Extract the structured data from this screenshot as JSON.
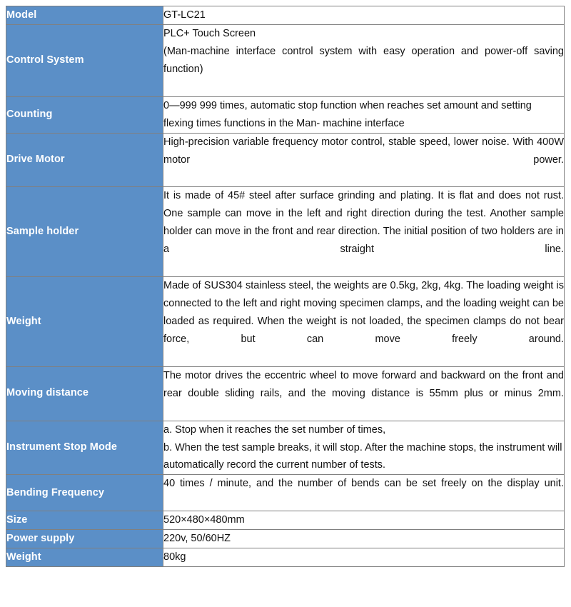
{
  "document": {
    "kind": "product-specification-table",
    "accent_color": "#5b8fc7",
    "label_text_color": "#ffffff",
    "value_text_color": "#111111",
    "border_color": "#808080",
    "background_color": "#ffffff"
  },
  "table": {
    "rows": [
      {
        "label": "Model",
        "lines": [
          {
            "text": "GT-LC21",
            "align": "left"
          }
        ]
      },
      {
        "label": "Control System",
        "lines": [
          {
            "text": "PLC+ Touch Screen",
            "align": "left"
          },
          {
            "text": "(Man-machine interface control system with easy operation and power-off saving function)",
            "align": "justify"
          }
        ]
      },
      {
        "label": "Counting",
        "lines": [
          {
            "text": "0—999 999 times, automatic stop function when reaches set amount and setting flexing times functions in the Man- machine interface",
            "align": "left"
          }
        ]
      },
      {
        "label": "Drive Motor",
        "lines": [
          {
            "text": "High-precision variable frequency motor control, stable speed, lower noise. With 400W motor power.",
            "align": "justify"
          }
        ]
      },
      {
        "label": "Sample holder",
        "lines": [
          {
            "text": "It is made of 45# steel after surface grinding and plating. It is flat and does not rust. One sample can move in the left and right direction during the test. Another sample holder can move in the front and rear direction. The initial position of two holders are in a straight line.",
            "align": "justify"
          }
        ]
      },
      {
        "label": "Weight",
        "lines": [
          {
            "text": "Made of SUS304 stainless steel, the weights are 0.5kg, 2kg, 4kg. The loading weight is connected to the left and right moving specimen clamps, and the loading weight can be loaded as required. When the weight is not loaded, the specimen clamps do not bear force, but can move freely around.",
            "align": "justify"
          }
        ]
      },
      {
        "label": "Moving distance",
        "lines": [
          {
            "text": "The motor drives the eccentric wheel to move forward and backward on the front and rear double sliding rails, and the moving distance is 55mm plus or minus 2mm.",
            "align": "justify"
          }
        ]
      },
      {
        "label": "Instrument Stop Mode",
        "lines": [
          {
            "text": "a. Stop when it reaches the set number of times,",
            "align": "left"
          },
          {
            "text": "b. When the test sample breaks, it will stop. After the machine stops, the instrument will automatically record the current number of tests.",
            "align": "left"
          }
        ]
      },
      {
        "label": "Bending Frequency",
        "lines": [
          {
            "text": "40 times / minute, and the number of bends can be set freely on the display unit.",
            "align": "justify"
          }
        ]
      },
      {
        "label": "Size",
        "lines": [
          {
            "text": "520×480×480mm",
            "align": "left"
          }
        ]
      },
      {
        "label": "Power supply",
        "lines": [
          {
            "text": "220v, 50/60HZ",
            "align": "left"
          }
        ]
      },
      {
        "label": "Weight",
        "lines": [
          {
            "text": "80kg",
            "align": "left"
          }
        ]
      }
    ]
  }
}
